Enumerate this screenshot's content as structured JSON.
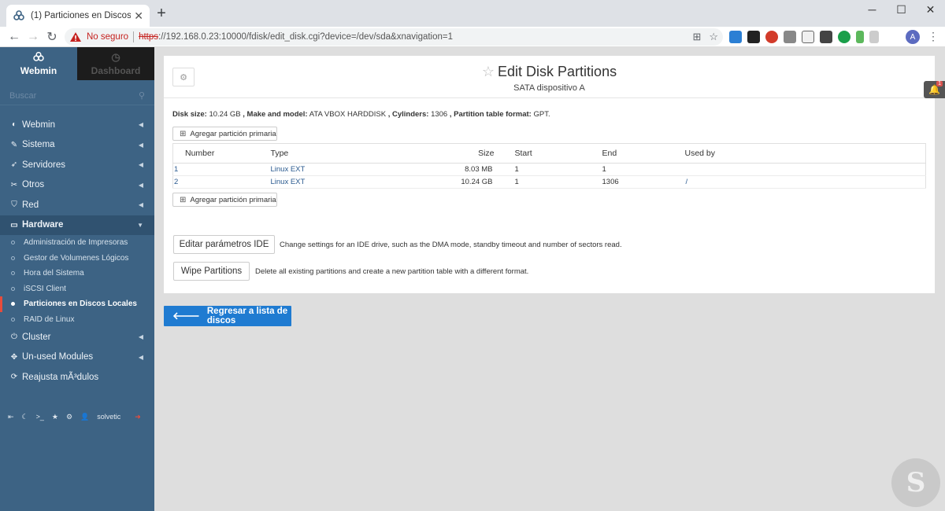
{
  "browser": {
    "tab_title": "(1) Particiones en Discos Locales",
    "new_tab_label": "+",
    "not_secure": "No seguro",
    "url_scheme": "https",
    "url_rest": "://192.168.0.23:10000/fdisk/edit_disk.cgi?device=/dev/sda&xnavigation=1",
    "profile_initial": "A"
  },
  "sidebar": {
    "tabs": {
      "webmin": "Webmin",
      "dashboard": "Dashboard"
    },
    "search_placeholder": "Buscar",
    "items": [
      {
        "label": "Webmin",
        "icon": "gauge-icon"
      },
      {
        "label": "Sistema",
        "icon": "wrench-icon"
      },
      {
        "label": "Servidores",
        "icon": "rocket-icon"
      },
      {
        "label": "Otros",
        "icon": "tools-icon"
      },
      {
        "label": "Red",
        "icon": "shield-icon"
      },
      {
        "label": "Hardware",
        "icon": "hdd-icon"
      }
    ],
    "hardware_sub": [
      "Administración de Impresoras",
      "Gestor de Volumenes Lógicos",
      "Hora del Sistema",
      "iSCSI Client",
      "Particiones en Discos Locales",
      "RAID de Linux"
    ],
    "items_after": [
      {
        "label": "Cluster",
        "icon": "power-icon"
      },
      {
        "label": "Un-used Modules",
        "icon": "puzzle-icon"
      },
      {
        "label": "Reajusta mÃ³dulos",
        "icon": "refresh-icon"
      }
    ],
    "user": "solvetic"
  },
  "main": {
    "title": "Edit Disk Partitions",
    "subtitle": "SATA dispositivo A",
    "disk_info": {
      "size_label": "Disk size:",
      "size": "10.24 GB",
      "model_label": ", Make and model:",
      "model": "ATA VBOX HARDDISK",
      "cyl_label": ", Cylinders:",
      "cylinders": "1306",
      "format_label": ", Partition table format:",
      "format": "GPT."
    },
    "add_primary_label": "Agregar partición primaria",
    "table": {
      "headers": [
        "Number",
        "Type",
        "Size",
        "Start",
        "End",
        "Used by"
      ],
      "rows": [
        {
          "number": "1",
          "type": "Linux EXT",
          "size": "8.03 MB",
          "start": "1",
          "end": "1",
          "used_by": ""
        },
        {
          "number": "2",
          "type": "Linux EXT",
          "size": "10.24 GB",
          "start": "1",
          "end": "1306",
          "used_by": "/"
        }
      ]
    },
    "ide_button": "Editar parámetros IDE",
    "ide_desc": "Change settings for an IDE drive, such as the DMA mode, standby timeout and number of sectors read.",
    "wipe_button": "Wipe Partitions",
    "wipe_desc": "Delete all existing partitions and create a new partition table with a different format.",
    "back_button": "Regresar a lista de discos",
    "notif_count": "1"
  },
  "colors": {
    "sidebar_bg": "#3d6384",
    "accent_blue": "#1f7bd1",
    "link_blue": "#2a5a8f",
    "current_marker": "#e74c3c"
  }
}
